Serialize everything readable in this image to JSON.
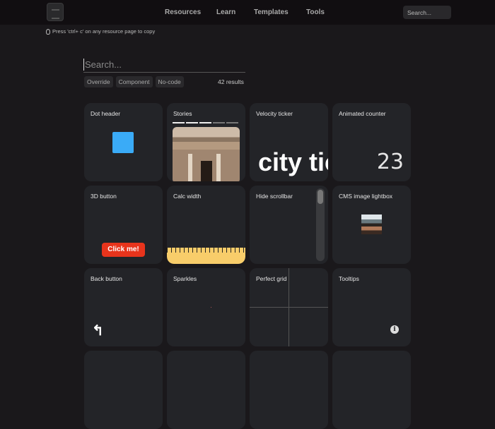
{
  "header": {
    "nav": [
      "Resources",
      "Learn",
      "Templates",
      "Tools"
    ],
    "search_placeholder": "Search..."
  },
  "tip": "Press 'ctrl+ c' on any resource page to copy",
  "search": {
    "placeholder": "Search..."
  },
  "filters": [
    "Override",
    "Component",
    "No-code"
  ],
  "results": "42 results",
  "cards": [
    {
      "title": "Dot header",
      "color": "#3aabf7"
    },
    {
      "title": "Stories"
    },
    {
      "title": "Velocity ticker",
      "preview": "city tic"
    },
    {
      "title": "Animated counter",
      "preview": "23"
    },
    {
      "title": "3D button",
      "preview": "Click me!",
      "color": "#e8341c"
    },
    {
      "title": "Calc width",
      "color": "#f8cd6a"
    },
    {
      "title": "Hide scrollbar"
    },
    {
      "title": "CMS image lightbox"
    },
    {
      "title": "Back button"
    },
    {
      "title": "Sparkles"
    },
    {
      "title": "Perfect grid"
    },
    {
      "title": "Tooltips"
    }
  ]
}
